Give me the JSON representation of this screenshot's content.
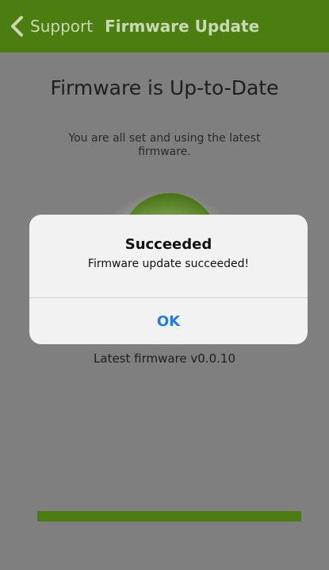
{
  "header": {
    "back_label": "Support",
    "title": "Firmware Update"
  },
  "main": {
    "title": "Firmware is Up-to-Date",
    "subtitle": "You are all set and using the latest firmware.",
    "latest_firmware": "Latest firmware v0.0.10"
  },
  "progress": {
    "value": 1.0
  },
  "dialog": {
    "title": "Succeeded",
    "message": "Firmware update succeeded!",
    "button_label": "OK"
  },
  "colors": {
    "header_bg": "#4b7d10",
    "header_text": "#c9d9b3",
    "dim_bg": "#7f7f7f",
    "status_circle": "#3f6d0c",
    "progress": "#4b7d10",
    "dialog_bg": "#f2f2f2",
    "dialog_button": "#1a7cf5"
  },
  "icons": {
    "back": "chevron-left-icon",
    "status": "status-circle-icon"
  }
}
